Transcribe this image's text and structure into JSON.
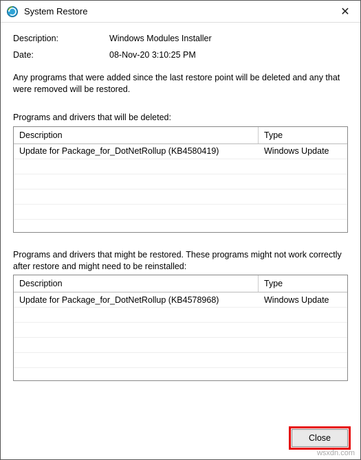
{
  "window": {
    "title": "System Restore",
    "close_glyph": "✕"
  },
  "fields": {
    "description_label": "Description:",
    "description_value": "Windows Modules Installer",
    "date_label": "Date:",
    "date_value": "08-Nov-20 3:10:25 PM"
  },
  "info": "Any programs that were added since the last restore point will be deleted and any that were removed will be restored.",
  "table_deleted": {
    "label": "Programs and drivers that will be deleted:",
    "headers": {
      "description": "Description",
      "type": "Type"
    },
    "rows": [
      {
        "description": "Update for Package_for_DotNetRollup (KB4580419)",
        "type": "Windows Update"
      }
    ]
  },
  "table_restored": {
    "label": "Programs and drivers that might be restored. These programs might not work correctly after restore and might need to be reinstalled:",
    "headers": {
      "description": "Description",
      "type": "Type"
    },
    "rows": [
      {
        "description": "Update for Package_for_DotNetRollup (KB4578968)",
        "type": "Windows Update"
      }
    ]
  },
  "footer": {
    "close_label": "Close"
  },
  "watermark": "wsxdn.com"
}
